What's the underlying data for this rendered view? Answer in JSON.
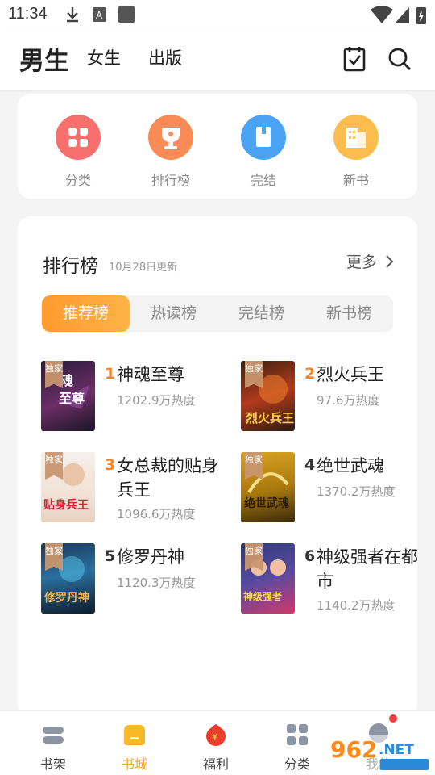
{
  "status_bar": {
    "time": "11:34"
  },
  "top_tabs": [
    {
      "label": "男生",
      "active": true
    },
    {
      "label": "女生",
      "active": false
    },
    {
      "label": "出版",
      "active": false
    }
  ],
  "quick_entries": [
    {
      "label": "分类",
      "icon": "grid-icon",
      "color": "#f7706d"
    },
    {
      "label": "排行榜",
      "icon": "trophy-icon",
      "color": "#fb8b56"
    },
    {
      "label": "完结",
      "icon": "book-icon",
      "color": "#4aa3f5"
    },
    {
      "label": "新书",
      "icon": "building-icon",
      "color": "#fbbd4e"
    }
  ],
  "ranking": {
    "title": "排行榜",
    "updated": "10月28日更新",
    "more": "更多",
    "tabs": [
      "推荐榜",
      "热读榜",
      "完结榜",
      "新书榜"
    ],
    "active_tab": 0,
    "exclusive_label": "独家",
    "books": [
      {
        "rank": "1",
        "title": "神魂至尊",
        "heat": "1202.9万热度",
        "rank_color": "#f5862a"
      },
      {
        "rank": "2",
        "title": "烈火兵王",
        "heat": "97.6万热度",
        "rank_color": "#f5862a"
      },
      {
        "rank": "3",
        "title": "女总裁的贴身兵王",
        "heat": "1096.6万热度",
        "rank_color": "#f5862a"
      },
      {
        "rank": "4",
        "title": "绝世武魂",
        "heat": "1370.2万热度",
        "rank_color": "#333333"
      },
      {
        "rank": "5",
        "title": "修罗丹神",
        "heat": "1120.3万热度",
        "rank_color": "#333333"
      },
      {
        "rank": "6",
        "title": "神级强者在都市",
        "heat": "1140.2万热度",
        "rank_color": "#333333"
      }
    ]
  },
  "bottom_nav": [
    {
      "label": "书架",
      "icon": "bookshelf-icon",
      "active": false
    },
    {
      "label": "书城",
      "icon": "bookstore-icon",
      "active": true
    },
    {
      "label": "福利",
      "icon": "gift-icon",
      "active": false
    },
    {
      "label": "分类",
      "icon": "grid-icon",
      "active": false
    },
    {
      "label": "我的",
      "icon": "profile-icon",
      "active": false
    }
  ],
  "accent_color": "#f5a623"
}
